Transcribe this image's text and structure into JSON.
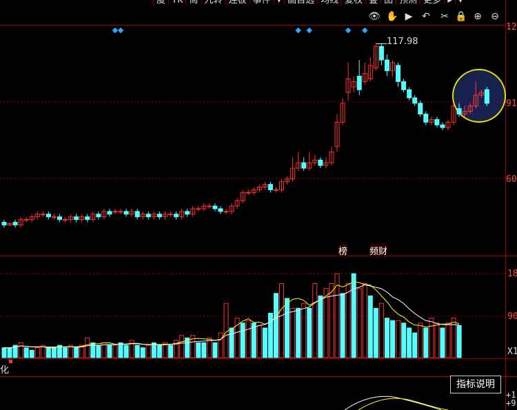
{
  "toolbar": {
    "tabs": [
      "度",
      "TK",
      "筒",
      "九转",
      "连板",
      "事件",
      "▾",
      "画自选",
      "均线",
      "复权",
      "叠",
      "图",
      "预测",
      "更多",
      "▸",
      "▾"
    ]
  },
  "icons": [
    "eye-icon",
    "hand-icon",
    "play-icon",
    "undo-icon",
    "scissors-icon",
    "lock-icon",
    "zoom-in-icon",
    "zoom-out-icon"
  ],
  "icon_glyphs": [
    "👁",
    "✋",
    "▶",
    "↶",
    "✂",
    "🔒",
    "⊕",
    "⊖"
  ],
  "price_panel": {
    "y_labels": [
      "12",
      "91",
      "60"
    ],
    "high_label": "117.98",
    "tags": [
      "榜",
      "频财"
    ]
  },
  "volume_panel": {
    "y_labels": [
      "18",
      "90",
      "X1"
    ]
  },
  "sub_panel": {
    "name": "化",
    "explain_button": "指标说明",
    "y_labels": [
      "+1",
      "+9"
    ]
  },
  "colors": {
    "up": "#ff3030",
    "down": "#54ffff",
    "ma1": "#ffffff",
    "ma2": "#ffff00",
    "grid": "#a00000"
  },
  "chart_data": {
    "type": "candlestick",
    "price_axis": {
      "visible_ticks": [
        "12",
        "91",
        "60"
      ]
    },
    "annotation_high": 117.98,
    "candles": [
      {
        "o": 52,
        "c": 51,
        "h": 53,
        "l": 50
      },
      {
        "o": 51,
        "c": 51.5,
        "h": 52,
        "l": 50.5
      },
      {
        "o": 52,
        "c": 51,
        "h": 53,
        "l": 50
      },
      {
        "o": 51,
        "c": 53,
        "h": 54,
        "l": 50
      },
      {
        "o": 53,
        "c": 53,
        "h": 54,
        "l": 52
      },
      {
        "o": 53,
        "c": 54,
        "h": 55,
        "l": 52
      },
      {
        "o": 54,
        "c": 55,
        "h": 56,
        "l": 53
      },
      {
        "o": 55,
        "c": 55,
        "h": 56,
        "l": 54
      },
      {
        "o": 55,
        "c": 54,
        "h": 56,
        "l": 53
      },
      {
        "o": 54,
        "c": 54,
        "h": 55,
        "l": 53
      },
      {
        "o": 54,
        "c": 53,
        "h": 55,
        "l": 52
      },
      {
        "o": 53,
        "c": 53,
        "h": 54,
        "l": 52
      },
      {
        "o": 53,
        "c": 54,
        "h": 55,
        "l": 52
      },
      {
        "o": 54,
        "c": 53,
        "h": 55,
        "l": 52
      },
      {
        "o": 53,
        "c": 54,
        "h": 55,
        "l": 52
      },
      {
        "o": 54,
        "c": 53,
        "h": 55,
        "l": 52
      },
      {
        "o": 53,
        "c": 55,
        "h": 56,
        "l": 52
      },
      {
        "o": 55,
        "c": 54,
        "h": 56,
        "l": 53
      },
      {
        "o": 54,
        "c": 56,
        "h": 57,
        "l": 53
      },
      {
        "o": 56,
        "c": 55,
        "h": 57,
        "l": 54
      },
      {
        "o": 56,
        "c": 56,
        "h": 57,
        "l": 55
      },
      {
        "o": 56,
        "c": 56,
        "h": 57,
        "l": 55
      },
      {
        "o": 56,
        "c": 55,
        "h": 57,
        "l": 54
      },
      {
        "o": 55,
        "c": 56,
        "h": 57,
        "l": 54
      },
      {
        "o": 56,
        "c": 54,
        "h": 57,
        "l": 53
      },
      {
        "o": 54,
        "c": 55,
        "h": 56,
        "l": 53
      },
      {
        "o": 55,
        "c": 54,
        "h": 56,
        "l": 53
      },
      {
        "o": 54,
        "c": 55,
        "h": 56,
        "l": 53
      },
      {
        "o": 55,
        "c": 54,
        "h": 56,
        "l": 53
      },
      {
        "o": 54,
        "c": 55,
        "h": 56,
        "l": 53
      },
      {
        "o": 55,
        "c": 55,
        "h": 56,
        "l": 54
      },
      {
        "o": 55,
        "c": 54,
        "h": 56,
        "l": 53
      },
      {
        "o": 54,
        "c": 56,
        "h": 57,
        "l": 53
      },
      {
        "o": 56,
        "c": 55,
        "h": 57,
        "l": 54
      },
      {
        "o": 55,
        "c": 57,
        "h": 58,
        "l": 54
      },
      {
        "o": 57,
        "c": 57,
        "h": 58,
        "l": 56
      },
      {
        "o": 57,
        "c": 58,
        "h": 59,
        "l": 56
      },
      {
        "o": 58,
        "c": 58,
        "h": 59,
        "l": 57
      },
      {
        "o": 58,
        "c": 57,
        "h": 59,
        "l": 56
      },
      {
        "o": 57,
        "c": 56,
        "h": 58,
        "l": 55
      },
      {
        "o": 56,
        "c": 56,
        "h": 57,
        "l": 55
      },
      {
        "o": 56,
        "c": 58,
        "h": 59,
        "l": 55
      },
      {
        "o": 58,
        "c": 60,
        "h": 61,
        "l": 57
      },
      {
        "o": 60,
        "c": 63,
        "h": 64,
        "l": 59
      },
      {
        "o": 63,
        "c": 63,
        "h": 64,
        "l": 62
      },
      {
        "o": 63,
        "c": 64,
        "h": 65,
        "l": 62
      },
      {
        "o": 64,
        "c": 65,
        "h": 66,
        "l": 63
      },
      {
        "o": 65,
        "c": 66,
        "h": 67,
        "l": 64
      },
      {
        "o": 66,
        "c": 64,
        "h": 67,
        "l": 63
      },
      {
        "o": 64,
        "c": 64,
        "h": 65,
        "l": 63
      },
      {
        "o": 64,
        "c": 67,
        "h": 68,
        "l": 63
      },
      {
        "o": 67,
        "c": 68,
        "h": 69,
        "l": 66
      },
      {
        "o": 68,
        "c": 72,
        "h": 76,
        "l": 67
      },
      {
        "o": 72,
        "c": 74,
        "h": 78,
        "l": 71
      },
      {
        "o": 74,
        "c": 72,
        "h": 76,
        "l": 71
      },
      {
        "o": 72,
        "c": 74,
        "h": 78,
        "l": 71
      },
      {
        "o": 74,
        "c": 75,
        "h": 77,
        "l": 73
      },
      {
        "o": 75,
        "c": 73,
        "h": 76,
        "l": 72
      },
      {
        "o": 73,
        "c": 74,
        "h": 76,
        "l": 72
      },
      {
        "o": 74,
        "c": 78,
        "h": 80,
        "l": 73
      },
      {
        "o": 80,
        "c": 89,
        "h": 92,
        "l": 78
      },
      {
        "o": 89,
        "c": 96,
        "h": 98,
        "l": 88
      },
      {
        "o": 100,
        "c": 105,
        "h": 111,
        "l": 97
      },
      {
        "o": 102,
        "c": 104,
        "h": 106,
        "l": 100
      },
      {
        "o": 106,
        "c": 101,
        "h": 112,
        "l": 99
      },
      {
        "o": 104,
        "c": 107,
        "h": 111,
        "l": 103
      },
      {
        "o": 105,
        "c": 110,
        "h": 113,
        "l": 104
      },
      {
        "o": 109,
        "c": 117,
        "h": 117.98,
        "l": 108
      },
      {
        "o": 117,
        "c": 112,
        "h": 118,
        "l": 110
      },
      {
        "o": 112,
        "c": 108,
        "h": 114,
        "l": 106
      },
      {
        "o": 108,
        "c": 111,
        "h": 112,
        "l": 106
      },
      {
        "o": 110,
        "c": 104,
        "h": 111,
        "l": 102
      },
      {
        "o": 104,
        "c": 101,
        "h": 105,
        "l": 100
      },
      {
        "o": 101,
        "c": 98,
        "h": 102,
        "l": 97
      },
      {
        "o": 98,
        "c": 96,
        "h": 99,
        "l": 95
      },
      {
        "o": 96,
        "c": 92,
        "h": 97,
        "l": 91
      },
      {
        "o": 92,
        "c": 89,
        "h": 93,
        "l": 88
      },
      {
        "o": 89,
        "c": 90,
        "h": 91,
        "l": 88
      },
      {
        "o": 90,
        "c": 88,
        "h": 91,
        "l": 87
      },
      {
        "o": 88,
        "c": 87,
        "h": 89,
        "l": 86
      },
      {
        "o": 87,
        "c": 89,
        "h": 90,
        "l": 86
      },
      {
        "o": 89,
        "c": 95,
        "h": 96,
        "l": 88
      },
      {
        "o": 94,
        "c": 92,
        "h": 96,
        "l": 91
      },
      {
        "o": 92,
        "c": 93,
        "h": 95,
        "l": 91
      },
      {
        "o": 93,
        "c": 95,
        "h": 96,
        "l": 92
      },
      {
        "o": 95,
        "c": 99,
        "h": 104,
        "l": 94
      },
      {
        "o": 99,
        "c": 100,
        "h": 101,
        "l": 98
      },
      {
        "o": 101,
        "c": 96,
        "h": 102,
        "l": 95
      }
    ],
    "volumes": [
      {
        "v": 4,
        "up": false
      },
      {
        "v": 4,
        "up": false
      },
      {
        "v": 5,
        "up": false
      },
      {
        "v": 6,
        "up": true
      },
      {
        "v": 4,
        "up": false
      },
      {
        "v": 3,
        "up": false
      },
      {
        "v": 4,
        "up": true
      },
      {
        "v": 5,
        "up": true
      },
      {
        "v": 4,
        "up": false
      },
      {
        "v": 4,
        "up": false
      },
      {
        "v": 5,
        "up": false
      },
      {
        "v": 4,
        "up": false
      },
      {
        "v": 5,
        "up": true
      },
      {
        "v": 4,
        "up": false
      },
      {
        "v": 5,
        "up": true
      },
      {
        "v": 8,
        "up": true
      },
      {
        "v": 6,
        "up": false
      },
      {
        "v": 5,
        "up": false
      },
      {
        "v": 6,
        "up": true
      },
      {
        "v": 5,
        "up": false
      },
      {
        "v": 5,
        "up": true
      },
      {
        "v": 6,
        "up": false
      },
      {
        "v": 5,
        "up": false
      },
      {
        "v": 7,
        "up": true
      },
      {
        "v": 5,
        "up": false
      },
      {
        "v": 4,
        "up": false
      },
      {
        "v": 5,
        "up": true
      },
      {
        "v": 6,
        "up": false
      },
      {
        "v": 5,
        "up": false
      },
      {
        "v": 6,
        "up": true
      },
      {
        "v": 5,
        "up": false
      },
      {
        "v": 7,
        "up": true
      },
      {
        "v": 9,
        "up": true
      },
      {
        "v": 8,
        "up": false
      },
      {
        "v": 9,
        "up": true
      },
      {
        "v": 6,
        "up": false
      },
      {
        "v": 6,
        "up": false
      },
      {
        "v": 8,
        "up": true
      },
      {
        "v": 6,
        "up": false
      },
      {
        "v": 10,
        "up": true
      },
      {
        "v": 22,
        "up": true
      },
      {
        "v": 12,
        "up": false
      },
      {
        "v": 16,
        "up": true
      },
      {
        "v": 14,
        "up": false
      },
      {
        "v": 15,
        "up": true
      },
      {
        "v": 14,
        "up": false
      },
      {
        "v": 13,
        "up": true
      },
      {
        "v": 12,
        "up": false
      },
      {
        "v": 18,
        "up": false
      },
      {
        "v": 26,
        "up": false
      },
      {
        "v": 30,
        "up": true
      },
      {
        "v": 24,
        "up": false
      },
      {
        "v": 20,
        "up": true
      },
      {
        "v": 20,
        "up": false
      },
      {
        "v": 22,
        "up": true
      },
      {
        "v": 20,
        "up": false
      },
      {
        "v": 30,
        "up": true
      },
      {
        "v": 25,
        "up": false
      },
      {
        "v": 28,
        "up": true
      },
      {
        "v": 30,
        "up": true
      },
      {
        "v": 34,
        "up": true
      },
      {
        "v": 26,
        "up": false
      },
      {
        "v": 30,
        "up": true
      },
      {
        "v": 34,
        "up": false
      },
      {
        "v": 28,
        "up": true
      },
      {
        "v": 30,
        "up": true
      },
      {
        "v": 25,
        "up": false
      },
      {
        "v": 20,
        "up": false
      },
      {
        "v": 22,
        "up": true
      },
      {
        "v": 16,
        "up": false
      },
      {
        "v": 15,
        "up": false
      },
      {
        "v": 15,
        "up": true
      },
      {
        "v": 14,
        "up": false
      },
      {
        "v": 12,
        "up": false
      },
      {
        "v": 10,
        "up": false
      },
      {
        "v": 14,
        "up": true
      },
      {
        "v": 12,
        "up": false
      },
      {
        "v": 16,
        "up": true
      },
      {
        "v": 14,
        "up": true
      },
      {
        "v": 12,
        "up": false
      },
      {
        "v": 14,
        "up": true
      },
      {
        "v": 16,
        "up": true
      },
      {
        "v": 13,
        "up": false
      }
    ],
    "markers": [
      "◆",
      "◆",
      "◆",
      "◆",
      "◆",
      "◆"
    ],
    "marker_bars": [
      20,
      21,
      53,
      55,
      62,
      65
    ]
  }
}
